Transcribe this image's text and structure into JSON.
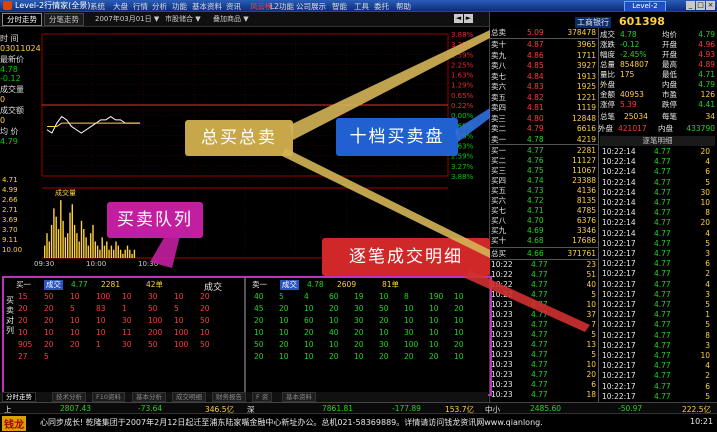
{
  "window": {
    "title": "Level-2行情家(全景)",
    "badge": "Level-2",
    "controls": [
      "_",
      "□",
      "×"
    ]
  },
  "menu": [
    "系统",
    "大盘",
    "行情",
    "分析",
    "功能",
    "基本资料",
    "资讯",
    "风云榜",
    "L2功能",
    "公司展示",
    "智能",
    "工具",
    "委托",
    "帮助"
  ],
  "menu_highlight_index": 7,
  "toolbar": {
    "tabs": [
      "分时走势",
      "分笔走势"
    ],
    "date": "2007年03月01日",
    "dd2": "市股储合 ▼",
    "dd3": "叠加商品 ▼"
  },
  "info": {
    "time_label": "时 间",
    "time_value": "03011024",
    "latest_label": "最新价",
    "latest_value": "4.78",
    "change_value": "-0.12",
    "vol_label": "成交量",
    "vol_value": "0",
    "amount_label": "成交额",
    "amount_value": "0",
    "avg_label": "均 价",
    "avg_value": "4.79"
  },
  "chart": {
    "left_labels": [
      "5.06",
      "4.99",
      "4.96",
      "4.93",
      "4.90",
      "4.87",
      "4.84",
      "4.81",
      "4.78",
      "4.75",
      "4.72",
      "4.69",
      "4.66",
      "4.63"
    ],
    "right_labels": [
      "3.88%",
      "3.27%",
      "2.59%",
      "2.25%",
      "1.63%",
      "1.29%",
      "0.65%",
      "0.22%",
      "0.00%",
      "0.65%",
      "1.29%",
      "1.63%",
      "2.59%",
      "3.27%",
      "3.88%"
    ],
    "vol_label": "成交量",
    "vol_ticks": [
      "4.71",
      "4.99",
      "2.66",
      "2.71",
      "3.69",
      "3.70",
      "9.11",
      "10.00"
    ],
    "time_ticks": [
      "09:30",
      "10:00",
      "10:30"
    ],
    "volume_bars": [
      3,
      6,
      4,
      8,
      12,
      10,
      7,
      14,
      9,
      5,
      6,
      11,
      13,
      8,
      6,
      4,
      9,
      7,
      5,
      3,
      6,
      8,
      4,
      3,
      2,
      5,
      3,
      4,
      2,
      3,
      2,
      4,
      3,
      2,
      1,
      2,
      3,
      2,
      1,
      2
    ],
    "price_line": [
      4.77,
      4.76,
      4.79,
      4.81,
      4.8,
      4.78,
      4.77,
      4.76,
      4.77,
      4.78,
      4.79,
      4.8,
      4.8,
      4.81,
      4.8,
      4.8,
      4.79,
      4.79,
      4.79,
      4.79
    ],
    "avg_line": [
      4.78,
      4.78,
      4.78,
      4.79,
      4.79,
      4.79,
      4.79,
      4.79,
      4.79,
      4.79,
      4.79,
      4.79,
      4.79,
      4.79,
      4.79,
      4.79,
      4.79,
      4.79,
      4.79,
      4.79
    ]
  },
  "stock": {
    "name": "工商银行",
    "code": "601398"
  },
  "orderbook": {
    "summary_top": {
      "label": "总卖",
      "price": "5.09",
      "vol": "378478"
    },
    "asks": [
      {
        "label": "卖十",
        "price": "4.87",
        "vol": "3965"
      },
      {
        "label": "卖九",
        "price": "4.86",
        "vol": "1711"
      },
      {
        "label": "卖八",
        "price": "4.85",
        "vol": "3927"
      },
      {
        "label": "卖七",
        "price": "4.84",
        "vol": "1913"
      },
      {
        "label": "卖六",
        "price": "4.83",
        "vol": "1925"
      },
      {
        "label": "卖五",
        "price": "4.82",
        "vol": "1221"
      },
      {
        "label": "卖四",
        "price": "4.81",
        "vol": "1119"
      },
      {
        "label": "卖三",
        "price": "4.80",
        "vol": "12848"
      },
      {
        "label": "卖二",
        "price": "4.79",
        "vol": "6616"
      },
      {
        "label": "卖一",
        "price": "4.78",
        "vol": "4219"
      }
    ],
    "bids": [
      {
        "label": "买一",
        "price": "4.77",
        "vol": "2281"
      },
      {
        "label": "买二",
        "price": "4.76",
        "vol": "11127"
      },
      {
        "label": "买三",
        "price": "4.75",
        "vol": "11067"
      },
      {
        "label": "买四",
        "price": "4.74",
        "vol": "23388"
      },
      {
        "label": "买五",
        "price": "4.73",
        "vol": "4136"
      },
      {
        "label": "买六",
        "price": "4.72",
        "vol": "8135"
      },
      {
        "label": "买七",
        "price": "4.71",
        "vol": "4785"
      },
      {
        "label": "买八",
        "price": "4.70",
        "vol": "6376"
      },
      {
        "label": "买九",
        "price": "4.69",
        "vol": "3346"
      },
      {
        "label": "买十",
        "price": "4.68",
        "vol": "17686"
      }
    ],
    "summary_bottom": {
      "label": "总买",
      "price": "4.66",
      "vol": "371761"
    }
  },
  "quote": {
    "rows": [
      [
        {
          "l": "成交",
          "v": "4.78",
          "c": "grn"
        },
        {
          "l": "均价",
          "v": "4.79",
          "c": "grn"
        }
      ],
      [
        {
          "l": "涨跌",
          "v": "-0.12",
          "c": "grn"
        },
        {
          "l": "开盘",
          "v": "4.96",
          "c": "red"
        }
      ],
      [
        {
          "l": "幅度",
          "v": "-2.45%",
          "c": "grn"
        },
        {
          "l": "开盘",
          "v": "4.93",
          "c": "red"
        }
      ],
      [
        {
          "l": "总量",
          "v": "854807",
          "c": "yel"
        },
        {
          "l": "最高",
          "v": "4.89",
          "c": "red"
        }
      ],
      [
        {
          "l": "量比",
          "v": "175",
          "c": "yel"
        },
        {
          "l": "最低",
          "v": "4.71",
          "c": "grn"
        }
      ],
      [
        {
          "l": "外盘",
          "v": "",
          "c": "yel"
        },
        {
          "l": "内盘",
          "v": "4.79",
          "c": "grn"
        }
      ],
      [
        {
          "l": "金额",
          "v": "40953",
          "c": "yel"
        },
        {
          "l": "市盈",
          "v": "126",
          "c": "yel"
        }
      ],
      [
        {
          "l": "涨停",
          "v": "5.39",
          "c": "red"
        },
        {
          "l": "跌停",
          "v": "4.41",
          "c": "grn"
        }
      ]
    ],
    "deals_label": "总笔",
    "deals_value": "25034",
    "deals_label2": "每笔",
    "deals_value2": "34",
    "out_label": "外盘",
    "out_value": "421017",
    "in_label": "内盘",
    "in_value": "433790",
    "ticks_title": "逐笔明细"
  },
  "ticks_left": [
    {
      "t": "10:22",
      "p": "4.77",
      "v": "23"
    },
    {
      "t": "10:22",
      "p": "4.77",
      "v": "51"
    },
    {
      "t": "10:22",
      "p": "4.77",
      "v": "40"
    },
    {
      "t": "10:22",
      "p": "4.77",
      "v": "5"
    },
    {
      "t": "10:23",
      "p": "4.77",
      "v": "10"
    },
    {
      "t": "10:23",
      "p": "4.77",
      "v": "37"
    },
    {
      "t": "10:23",
      "p": "4.77",
      "v": "7"
    },
    {
      "t": "10:23",
      "p": "4.77",
      "v": "5"
    },
    {
      "t": "10:23",
      "p": "4.77",
      "v": "13"
    },
    {
      "t": "10:23",
      "p": "4.77",
      "v": "5"
    },
    {
      "t": "10:23",
      "p": "4.77",
      "v": "10"
    },
    {
      "t": "10:23",
      "p": "4.77",
      "v": "20"
    },
    {
      "t": "10:23",
      "p": "4.77",
      "v": "6"
    },
    {
      "t": "10:23",
      "p": "4.77",
      "v": "18"
    }
  ],
  "ticks_right": [
    {
      "t": "10:22:14",
      "p": "4.77",
      "v": "20"
    },
    {
      "t": "10:22:14",
      "p": "4.77",
      "v": "4"
    },
    {
      "t": "10:22:14",
      "p": "4.77",
      "v": "6"
    },
    {
      "t": "10:22:14",
      "p": "4.77",
      "v": "5"
    },
    {
      "t": "10:22:14",
      "p": "4.77",
      "v": "30"
    },
    {
      "t": "10:22:14",
      "p": "4.77",
      "v": "10"
    },
    {
      "t": "10:22:14",
      "p": "4.77",
      "v": "8"
    },
    {
      "t": "10:22:14",
      "p": "4.77",
      "v": "20"
    },
    {
      "t": "10:22:14",
      "p": "4.77",
      "v": "4"
    },
    {
      "t": "10:22:17",
      "p": "4.77",
      "v": "5"
    },
    {
      "t": "10:22:17",
      "p": "4.77",
      "v": "3"
    },
    {
      "t": "10:22:17",
      "p": "4.77",
      "v": "6"
    },
    {
      "t": "10:22:17",
      "p": "4.77",
      "v": "2"
    },
    {
      "t": "10:22:17",
      "p": "4.77",
      "v": "4"
    },
    {
      "t": "10:22:17",
      "p": "4.77",
      "v": "3"
    },
    {
      "t": "10:22:17",
      "p": "4.77",
      "v": "5"
    },
    {
      "t": "10:22:17",
      "p": "4.77",
      "v": "1"
    },
    {
      "t": "10:22:17",
      "p": "4.77",
      "v": "5"
    },
    {
      "t": "10:22:17",
      "p": "4.77",
      "v": "8"
    },
    {
      "t": "10:22:17",
      "p": "4.77",
      "v": "3"
    },
    {
      "t": "10:22:17",
      "p": "4.77",
      "v": "10"
    },
    {
      "t": "10:22:17",
      "p": "4.77",
      "v": "4"
    },
    {
      "t": "10:22:17",
      "p": "4.77",
      "v": "2"
    },
    {
      "t": "10:22:17",
      "p": "4.77",
      "v": "6"
    },
    {
      "t": "10:22:17",
      "p": "4.77",
      "v": "5"
    }
  ],
  "queue": {
    "side_label": "买卖对列",
    "left_header": {
      "label": "买一",
      "badge": "成交",
      "price": "4.77",
      "vol": "2281",
      "count": "42单"
    },
    "left_rows": [
      [
        "15",
        "50",
        "10",
        "100",
        "10",
        "30",
        "10",
        "20"
      ],
      [
        "20",
        "20",
        "5",
        "83",
        "1",
        "50",
        "5",
        "20"
      ],
      [
        "20",
        "20",
        "10",
        "10",
        "30",
        "100",
        "10",
        "50"
      ],
      [
        "10",
        "10",
        "10",
        "10",
        "11",
        "200",
        "100",
        "10"
      ],
      [
        "905",
        "20",
        "20",
        "1",
        "30",
        "50",
        "100",
        "50"
      ],
      [
        "27",
        "5",
        "",
        "",
        "",
        "",
        "",
        ""
      ]
    ],
    "mid_label": "成交",
    "right_header": {
      "label": "卖一",
      "badge": "成交",
      "price": "4.78",
      "vol": "2609",
      "count": "81单"
    },
    "right_rows": [
      [
        "40",
        "5",
        "4",
        "60",
        "19",
        "10",
        "8",
        "190",
        "10"
      ],
      [
        "45",
        "20",
        "10",
        "20",
        "30",
        "50",
        "10",
        "10",
        "20"
      ],
      [
        "20",
        "10",
        "60",
        "10",
        "30",
        "20",
        "10",
        "10",
        "10"
      ],
      [
        "10",
        "10",
        "20",
        "40",
        "20",
        "10",
        "30",
        "10",
        "10"
      ],
      [
        "50",
        "20",
        "10",
        "10",
        "20",
        "30",
        "100",
        "10",
        "20"
      ],
      [
        "20",
        "10",
        "10",
        "20",
        "10",
        "20",
        "20",
        "20",
        "10"
      ]
    ]
  },
  "bottom_tabs": [
    "分时走势",
    "技术分析",
    "F10资料",
    "基本分析",
    "成交明细",
    "财务报告",
    "F 资",
    "基本资料"
  ],
  "status": {
    "a_label": "上",
    "a_val": "2807.43",
    "a_chg": "-73.64",
    "a_amt": "346.5亿",
    "b_label": "深",
    "b_val": "7861.81",
    "b_chg": "-177.89",
    "b_amt": "153.7亿",
    "c_label": "中小",
    "c_val": "2485.60",
    "c_chg": "-50.97",
    "c_amt": "222.5亿"
  },
  "ticker": {
    "logo": "钱龙",
    "text": "心同步成长! 乾隆集团于2007年2月12日起迁至浦东陆家嘴金融中心新址办公。总机021-58369889。详情请访问钱龙资讯网www.qianlong.",
    "time": "10:21"
  },
  "callouts": {
    "total": "总买总卖",
    "ten": "十档买卖盘",
    "queue": "买卖队列",
    "detail": "逐笔成交明细"
  }
}
